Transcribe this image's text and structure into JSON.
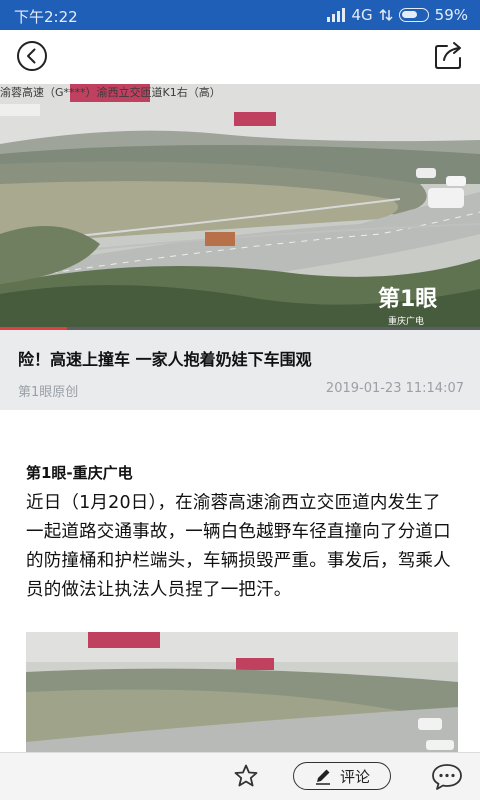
{
  "status_bar": {
    "time": "下午2:22",
    "network": "4G",
    "battery_percent": "59%"
  },
  "top_bar": {
    "back_icon": "back-circle-icon",
    "share_icon": "share-icon"
  },
  "hero": {
    "caption": "渝蓉高速（G****）渝西立交匝道K1右（高）",
    "watermark_top": "第1眼",
    "watermark_bottom": "重庆广电",
    "progress": 0.14
  },
  "headline": {
    "title": "险！高速上撞车 一家人抱着奶娃下车围观",
    "source": "第1眼原创",
    "date": "2019-01-23 11:14:07"
  },
  "article": {
    "byline": "第1眼-重庆广电",
    "paragraph": "近日（1月20日），在渝蓉高速渝西立交匝道内发生了一起道路交通事故，一辆白色越野车径直撞向了分道口的防撞桶和护栏端头，车辆损毁严重。事发后，驾乘人员的做法让执法人员捏了一把汗。"
  },
  "bottom_bar": {
    "favorite_icon": "star-icon",
    "comment_label": "评论",
    "comment_icon": "pencil-icon",
    "chat_icon": "chat-bubble-icon"
  },
  "colors": {
    "status_bar": "#1f5fb8",
    "progress": "#e04040",
    "title_panel": "#e9ebed"
  }
}
